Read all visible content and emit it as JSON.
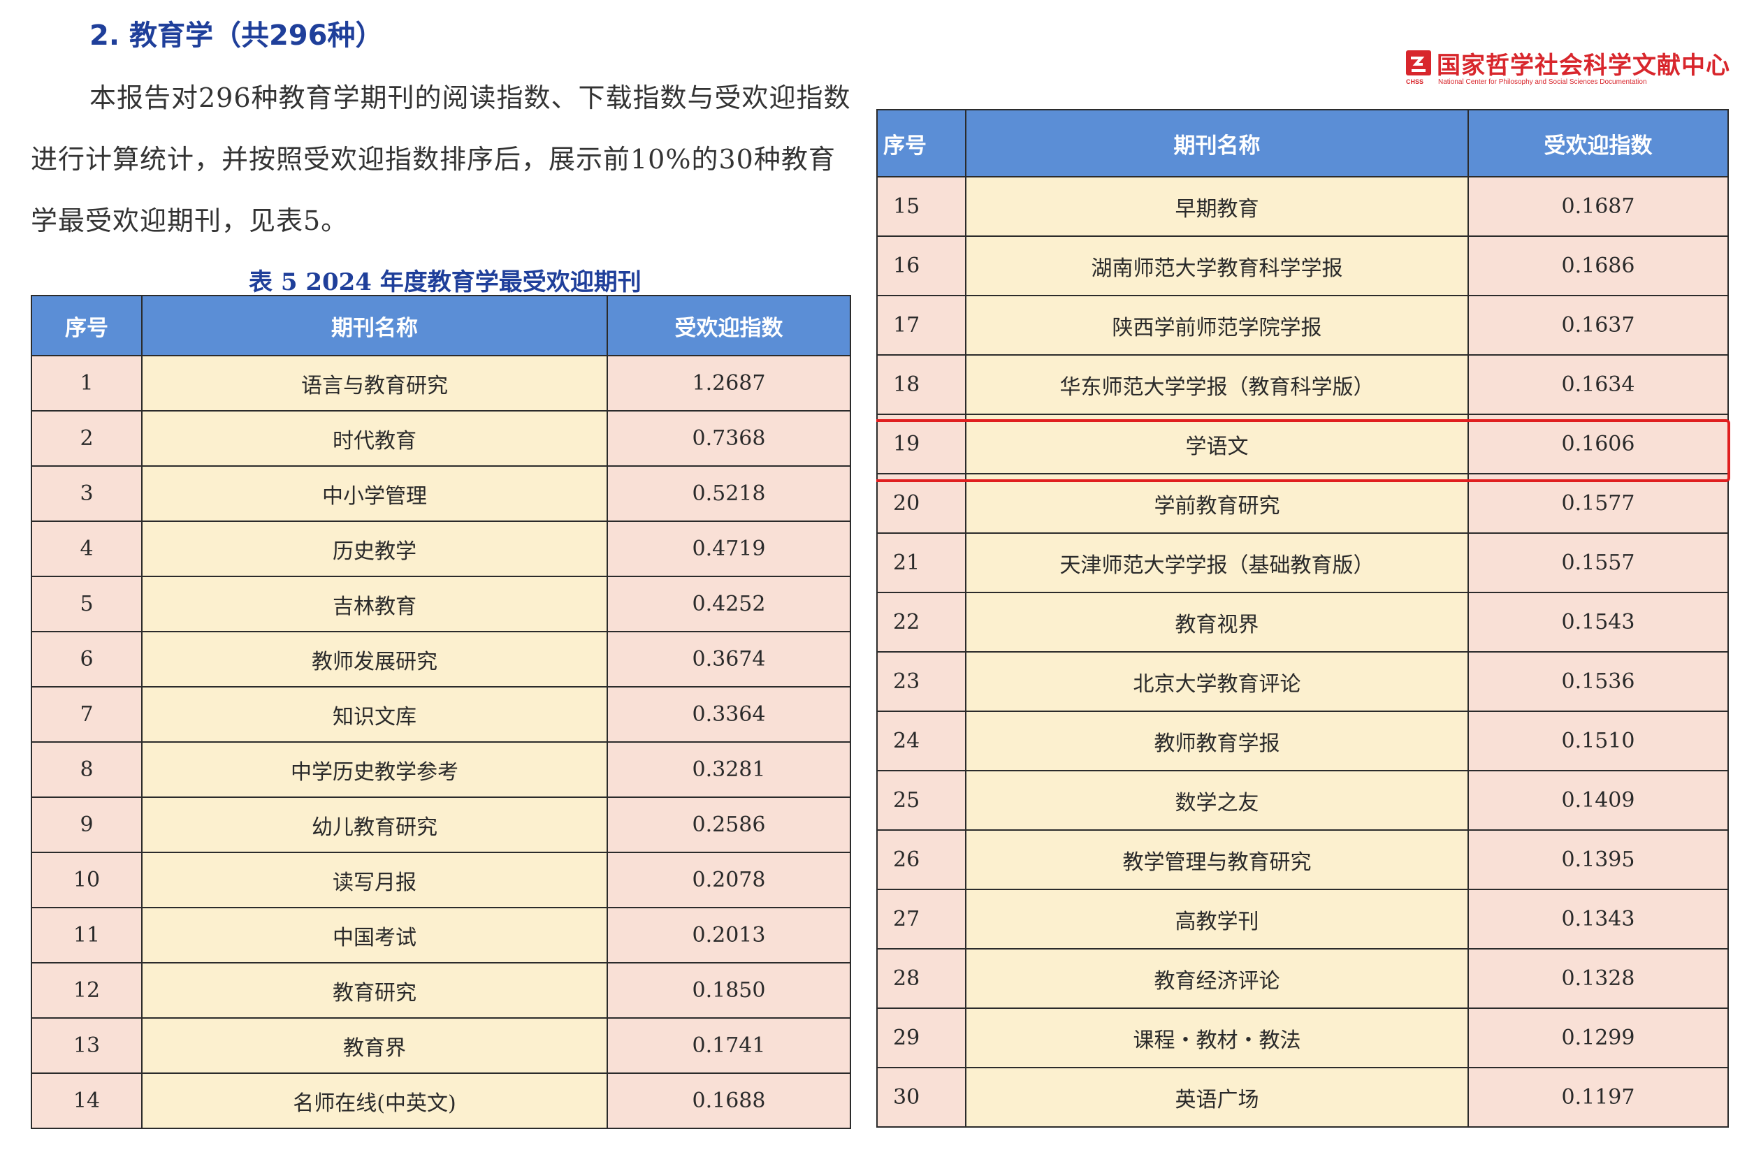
{
  "section_title": "2. 教育学（共296种）",
  "intro": "本报告对296种教育学期刊的阅读指数、下载指数与受欢迎指数进行计算统计，并按照受欢迎指数排序后，展示前10%的30种教育学最受欢迎期刊，见表5。",
  "table_caption": "表 5   2024 年度教育学最受欢迎期刊",
  "logo": {
    "cn": "国家哲学社会科学文献中心",
    "abbr": "CHSS",
    "en": "National Center for Philosophy and Social Sciences Documentation",
    "color": "#d8262c"
  },
  "headers": {
    "no": "序号",
    "name": "期刊名称",
    "value": "受欢迎指数"
  },
  "colors": {
    "header_bg": "#5b8ed6",
    "name_col": "#fcf0cf",
    "side_cols": "#f9e0d6",
    "highlight": "#e01f1f"
  },
  "highlight_row": "19",
  "rows_left": [
    {
      "no": "1",
      "name": "语言与教育研究",
      "value": "1.2687"
    },
    {
      "no": "2",
      "name": "时代教育",
      "value": "0.7368"
    },
    {
      "no": "3",
      "name": "中小学管理",
      "value": "0.5218"
    },
    {
      "no": "4",
      "name": "历史教学",
      "value": "0.4719"
    },
    {
      "no": "5",
      "name": "吉林教育",
      "value": "0.4252"
    },
    {
      "no": "6",
      "name": "教师发展研究",
      "value": "0.3674"
    },
    {
      "no": "7",
      "name": "知识文库",
      "value": "0.3364"
    },
    {
      "no": "8",
      "name": "中学历史教学参考",
      "value": "0.3281"
    },
    {
      "no": "9",
      "name": "幼儿教育研究",
      "value": "0.2586"
    },
    {
      "no": "10",
      "name": "读写月报",
      "value": "0.2078"
    },
    {
      "no": "11",
      "name": "中国考试",
      "value": "0.2013"
    },
    {
      "no": "12",
      "name": "教育研究",
      "value": "0.1850"
    },
    {
      "no": "13",
      "name": "教育界",
      "value": "0.1741"
    },
    {
      "no": "14",
      "name": "名师在线(中英文)",
      "value": "0.1688"
    }
  ],
  "rows_right": [
    {
      "no": "15",
      "name": "早期教育",
      "value": "0.1687"
    },
    {
      "no": "16",
      "name": "湖南师范大学教育科学学报",
      "value": "0.1686"
    },
    {
      "no": "17",
      "name": "陕西学前师范学院学报",
      "value": "0.1637"
    },
    {
      "no": "18",
      "name": "华东师范大学学报（教育科学版）",
      "value": "0.1634"
    },
    {
      "no": "19",
      "name": "学语文",
      "value": "0.1606"
    },
    {
      "no": "20",
      "name": "学前教育研究",
      "value": "0.1577"
    },
    {
      "no": "21",
      "name": "天津师范大学学报（基础教育版）",
      "value": "0.1557"
    },
    {
      "no": "22",
      "name": "教育视界",
      "value": "0.1543"
    },
    {
      "no": "23",
      "name": "北京大学教育评论",
      "value": "0.1536"
    },
    {
      "no": "24",
      "name": "教师教育学报",
      "value": "0.1510"
    },
    {
      "no": "25",
      "name": "数学之友",
      "value": "0.1409"
    },
    {
      "no": "26",
      "name": "教学管理与教育研究",
      "value": "0.1395"
    },
    {
      "no": "27",
      "name": "高教学刊",
      "value": "0.1343"
    },
    {
      "no": "28",
      "name": "教育经济评论",
      "value": "0.1328"
    },
    {
      "no": "29",
      "name": "课程・教材・教法",
      "value": "0.1299"
    },
    {
      "no": "30",
      "name": "英语广场",
      "value": "0.1197"
    }
  ]
}
